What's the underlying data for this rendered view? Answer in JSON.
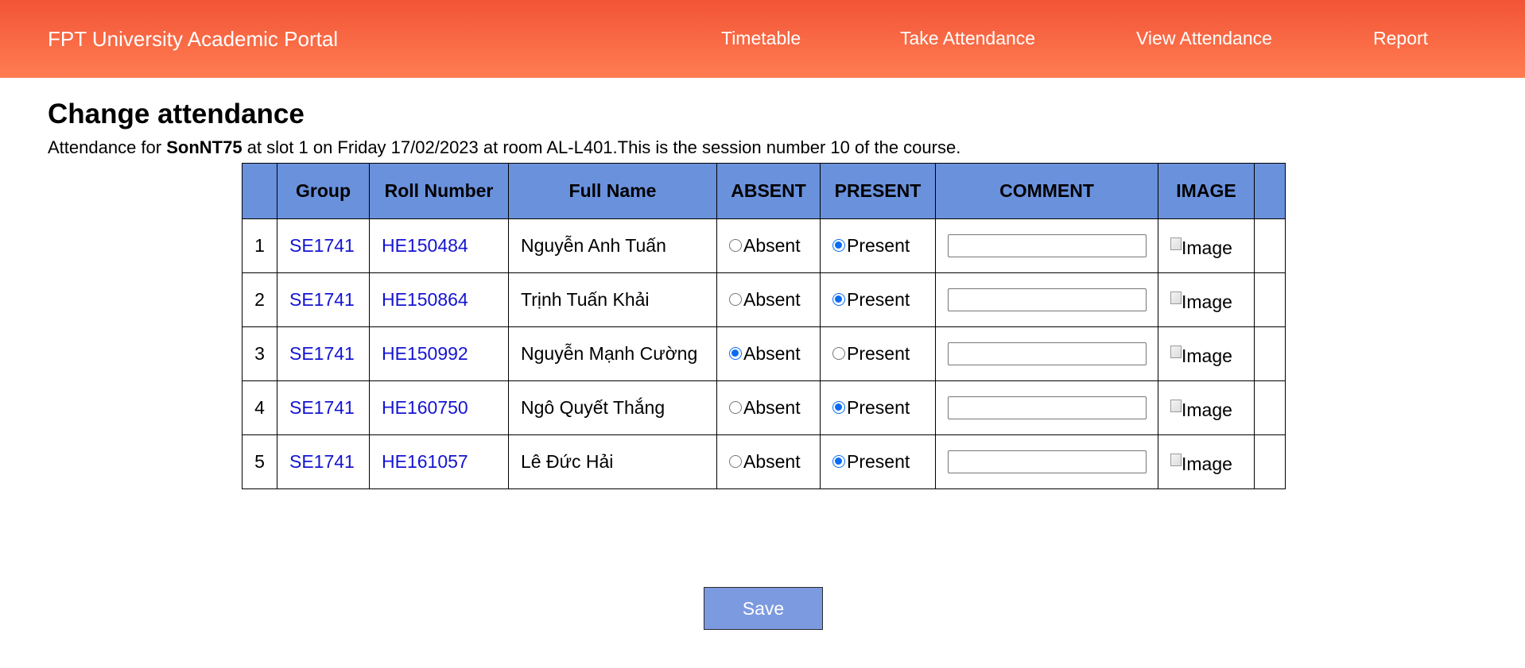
{
  "header": {
    "brand": "FPT University Academic Portal",
    "nav": [
      {
        "label": "Timetable"
      },
      {
        "label": "Take Attendance"
      },
      {
        "label": "View Attendance"
      },
      {
        "label": "Report"
      }
    ],
    "gradient_colors": [
      "#f25436",
      "#ff7d52"
    ]
  },
  "page": {
    "title": "Change attendance",
    "subtitle_prefix": "Attendance for ",
    "instructor": "SonNT75",
    "subtitle_suffix": " at slot 1 on Friday 17/02/2023 at room AL-L401.This is the session number 10 of the course."
  },
  "table": {
    "header_color": "#6a91dc",
    "link_color": "#1414d2",
    "columns": [
      "",
      "Group",
      "Roll Number",
      "Full Name",
      "ABSENT",
      "PRESENT",
      "COMMENT",
      "IMAGE",
      ""
    ],
    "absent_label": "Absent",
    "present_label": "Present",
    "image_alt": "Image",
    "rows": [
      {
        "index": "1",
        "group": "SE1741",
        "roll": "HE150484",
        "name": "Nguyễn Anh Tuấn",
        "status": "present",
        "comment": ""
      },
      {
        "index": "2",
        "group": "SE1741",
        "roll": "HE150864",
        "name": "Trịnh Tuấn Khải",
        "status": "present",
        "comment": ""
      },
      {
        "index": "3",
        "group": "SE1741",
        "roll": "HE150992",
        "name": "Nguyễn Mạnh Cường",
        "status": "absent",
        "comment": ""
      },
      {
        "index": "4",
        "group": "SE1741",
        "roll": "HE160750",
        "name": "Ngô Quyết Thắng",
        "status": "present",
        "comment": ""
      },
      {
        "index": "5",
        "group": "SE1741",
        "roll": "HE161057",
        "name": "Lê Đức Hải",
        "status": "present",
        "comment": ""
      }
    ]
  },
  "actions": {
    "save_label": "Save",
    "save_color": "#7c9ae0"
  }
}
